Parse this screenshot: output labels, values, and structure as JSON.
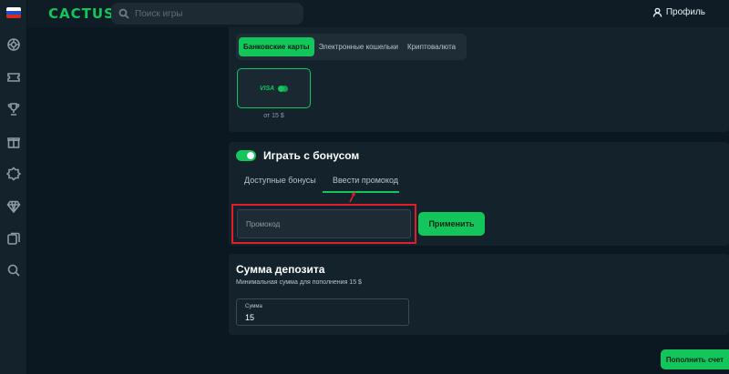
{
  "header": {
    "logo": "CACTUS",
    "search_placeholder": "Поиск игры",
    "profile_label": "Профиль"
  },
  "sidebar": {
    "flag": "russian-flag",
    "icons": [
      "casino-chip-icon",
      "ticket-icon",
      "trophy-icon",
      "gift-icon",
      "bonus-badge-icon",
      "diamond-icon",
      "cards-icon",
      "search-icon"
    ]
  },
  "payment": {
    "tabs": [
      "Банковские карты",
      "Электронные кошельки",
      "Криптовалюта"
    ],
    "active_tab": "Банковские карты",
    "card_brand": "VISA",
    "card_min": "от 15 $"
  },
  "bonus": {
    "title": "Играть с бонусом",
    "toggle_on": true,
    "tabs": [
      "Доступные бонусы",
      "Ввести промокод"
    ],
    "active_tab": "Ввести промокод",
    "promo_placeholder": "Промокод",
    "apply_label": "Применить"
  },
  "deposit": {
    "title": "Сумма депозита",
    "min_text": "Минимальная сумма для пополнения 15 $",
    "amount_label": "Сумма",
    "amount_value": "15",
    "submit_label": "Пополнить счет"
  },
  "colors": {
    "accent": "#12c65c",
    "background": "#0c1821",
    "panel": "#14222c",
    "highlight": "#e11d2a"
  }
}
